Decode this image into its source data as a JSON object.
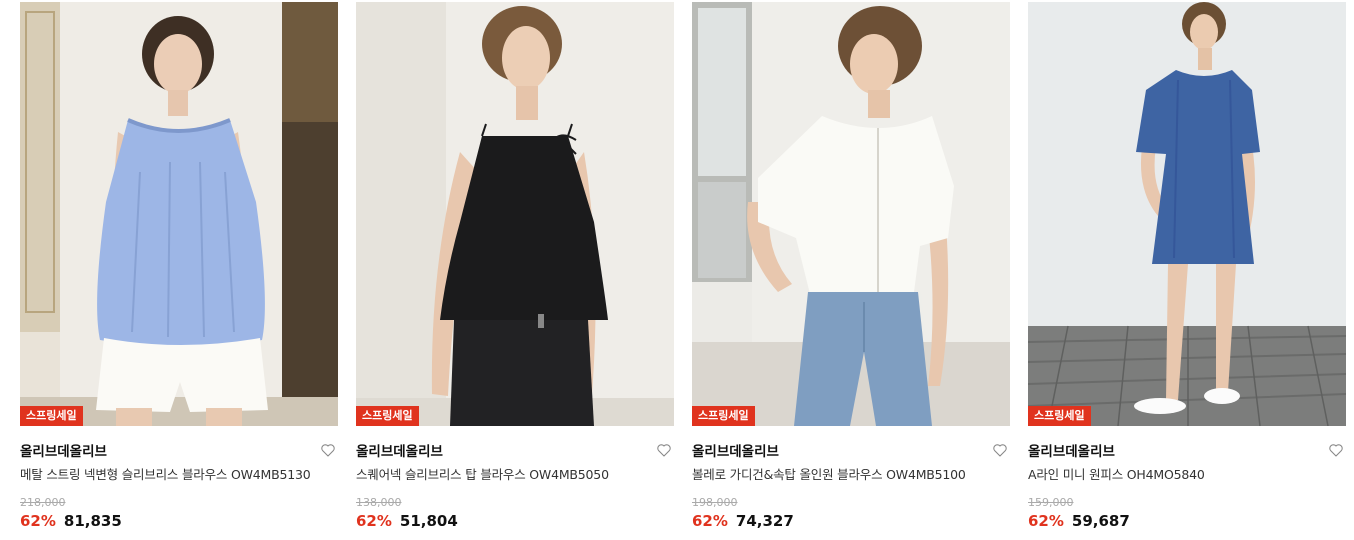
{
  "colors": {
    "accent": "#e0331e",
    "badge_bg": "#e0331e",
    "text": "#111111",
    "muted": "#aaaaaa"
  },
  "products": [
    {
      "badge": "스프링세일",
      "brand": "올리브데올리브",
      "name": "메탈 스트링 넥변형 슬리브리스 블라우스 OW4MB5130",
      "original_price": "218,000",
      "discount": "62%",
      "price": "81,835",
      "image_subject": "light blue sleeveless blouse with white shorts",
      "wishlist_icon": "heart-outline-icon"
    },
    {
      "badge": "스프링세일",
      "brand": "올리브데올리브",
      "name": "스퀘어넥 슬리브리스 탑 블라우스 OW4MB5050",
      "original_price": "138,000",
      "discount": "62%",
      "price": "51,804",
      "image_subject": "black square neck sleeveless top",
      "wishlist_icon": "heart-outline-icon"
    },
    {
      "badge": "스프링세일",
      "brand": "올리브데올리브",
      "name": "볼레로 가디건&속탑 올인원 블라우스 OW4MB5100",
      "original_price": "198,000",
      "discount": "62%",
      "price": "74,327",
      "image_subject": "white bolero blouse with denim jeans",
      "wishlist_icon": "heart-outline-icon"
    },
    {
      "badge": "스프링세일",
      "brand": "올리브데올리브",
      "name": "A라인 미니 원피스 OH4MO5840",
      "original_price": "159,000",
      "discount": "62%",
      "price": "59,687",
      "image_subject": "blue A-line mini dress",
      "wishlist_icon": "heart-outline-icon"
    }
  ]
}
